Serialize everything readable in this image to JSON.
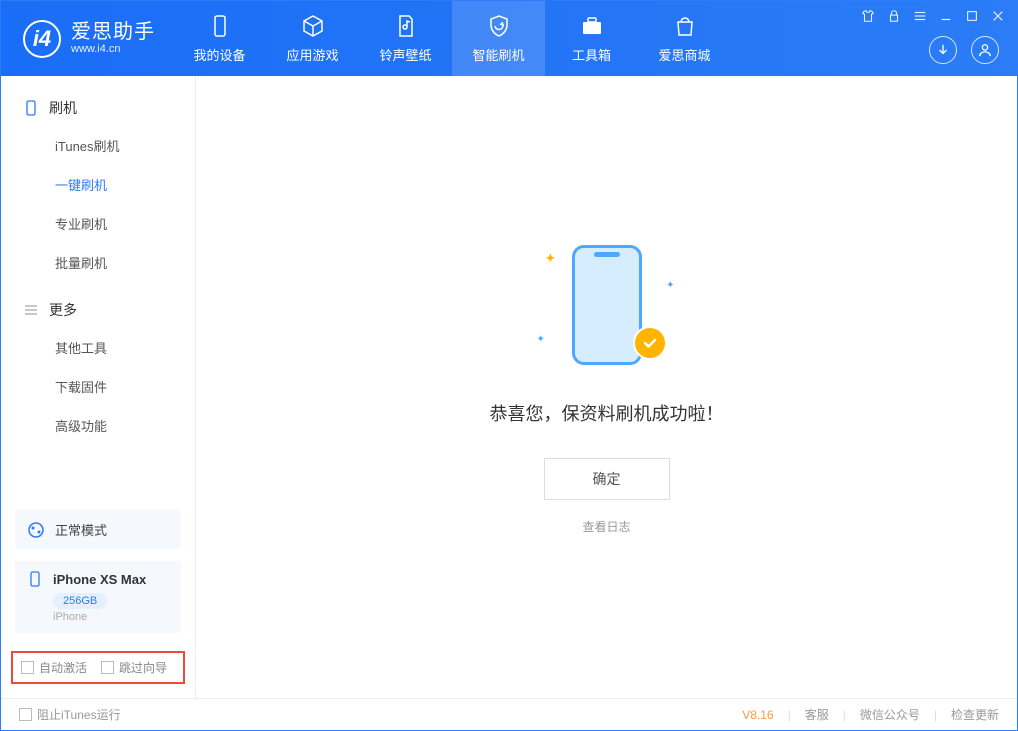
{
  "app": {
    "name_cn": "爱思助手",
    "name_en": "www.i4.cn"
  },
  "tabs": [
    {
      "label": "我的设备"
    },
    {
      "label": "应用游戏"
    },
    {
      "label": "铃声壁纸"
    },
    {
      "label": "智能刷机"
    },
    {
      "label": "工具箱"
    },
    {
      "label": "爱思商城"
    }
  ],
  "sidebar": {
    "section1_title": "刷机",
    "items1": [
      {
        "label": "iTunes刷机"
      },
      {
        "label": "一键刷机"
      },
      {
        "label": "专业刷机"
      },
      {
        "label": "批量刷机"
      }
    ],
    "section2_title": "更多",
    "items2": [
      {
        "label": "其他工具"
      },
      {
        "label": "下载固件"
      },
      {
        "label": "高级功能"
      }
    ],
    "mode_label": "正常模式",
    "device": {
      "name": "iPhone XS Max",
      "storage": "256GB",
      "type": "iPhone"
    },
    "checkbox1": "自动激活",
    "checkbox2": "跳过向导"
  },
  "main": {
    "success_text": "恭喜您，保资料刷机成功啦！",
    "ok_button": "确定",
    "log_link": "查看日志"
  },
  "footer": {
    "stop_itunes": "阻止iTunes运行",
    "version": "V8.16",
    "link1": "客服",
    "link2": "微信公众号",
    "link3": "检查更新"
  }
}
